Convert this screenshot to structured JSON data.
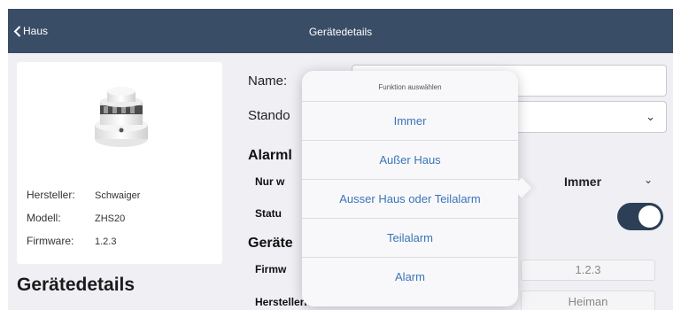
{
  "header": {
    "back_label": "Haus",
    "title": "Gerätedetails"
  },
  "device": {
    "manufacturer_label": "Hersteller:",
    "manufacturer_value": "Schwaiger",
    "model_label": "Modell:",
    "model_value": "ZHS20",
    "firmware_label": "Firmware:",
    "firmware_value": "1.2.3"
  },
  "caption": "Gerätedetails",
  "form": {
    "name_label": "Name:",
    "location_label": "Stando",
    "alarm_section": "Alarml",
    "only_when_label": "Nur w",
    "only_when_value": "Immer",
    "status_label": "Statu",
    "status_on": true,
    "device_section": "Geräte",
    "firmware_label": "Firmw",
    "firmware_value": "1.2.3",
    "manufacturer_label": "Herstellername",
    "manufacturer_value": "Heiman"
  },
  "popover": {
    "title": "Funktion auswählen",
    "options": [
      "Immer",
      "Außer Haus",
      "Ausser Haus oder Teilalarm",
      "Teilalarm",
      "Alarm"
    ]
  },
  "colors": {
    "nav_bar": "#3a4d66",
    "accent_blue": "#3a75b8",
    "toggle_on": "#2d3f57",
    "background": "#efeff4"
  }
}
